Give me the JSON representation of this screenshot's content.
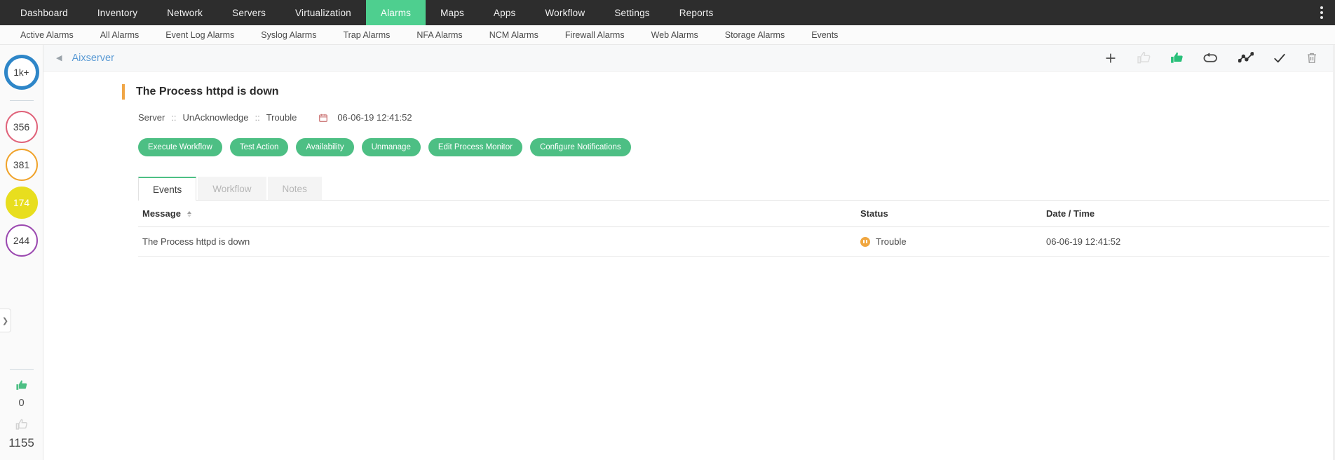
{
  "topnav": {
    "items": [
      {
        "label": "Dashboard",
        "active": false
      },
      {
        "label": "Inventory",
        "active": false
      },
      {
        "label": "Network",
        "active": false
      },
      {
        "label": "Servers",
        "active": false
      },
      {
        "label": "Virtualization",
        "active": false
      },
      {
        "label": "Alarms",
        "active": true
      },
      {
        "label": "Maps",
        "active": false
      },
      {
        "label": "Apps",
        "active": false
      },
      {
        "label": "Workflow",
        "active": false
      },
      {
        "label": "Settings",
        "active": false
      },
      {
        "label": "Reports",
        "active": false
      }
    ],
    "overflow_icon": "kebab-menu-icon",
    "active_color": "#4ecf8f",
    "background": "#2d2d2d"
  },
  "subnav": {
    "items": [
      {
        "label": "Active Alarms"
      },
      {
        "label": "All Alarms"
      },
      {
        "label": "Event Log Alarms"
      },
      {
        "label": "Syslog Alarms"
      },
      {
        "label": "Trap Alarms"
      },
      {
        "label": "NFA Alarms"
      },
      {
        "label": "NCM Alarms"
      },
      {
        "label": "Firewall Alarms"
      },
      {
        "label": "Web Alarms"
      },
      {
        "label": "Storage Alarms"
      },
      {
        "label": "Events"
      }
    ]
  },
  "rail": {
    "badges": [
      {
        "value": "1k+",
        "color": "#2e86c8",
        "style": "donut"
      },
      {
        "value": "356",
        "color": "#e0637a",
        "style": "ring"
      },
      {
        "value": "381",
        "color": "#f0a32b",
        "style": "ring"
      },
      {
        "value": "174",
        "color": "#e8de1e",
        "style": "filled"
      },
      {
        "value": "244",
        "color": "#9b49b0",
        "style": "ring"
      }
    ],
    "stats": [
      {
        "icon": "thumbs-up-icon",
        "value": "0",
        "color": "#4dbf84"
      },
      {
        "icon": "thumbs-up-outline-icon",
        "value": "1155",
        "color": "#d8d8d8"
      }
    ],
    "expand_icon": "chevron-right-icon"
  },
  "header": {
    "back_icon": "chevron-left-icon",
    "device_name": "Aixserver",
    "tools": [
      {
        "name": "add-icon",
        "label": "Add"
      },
      {
        "name": "thumbs-up-outline-icon",
        "label": "Unacknowledge"
      },
      {
        "name": "thumbs-up-filled-icon",
        "label": "Acknowledge"
      },
      {
        "name": "link-loop-icon",
        "label": "Link"
      },
      {
        "name": "line-chart-icon",
        "label": "Performance"
      },
      {
        "name": "check-icon",
        "label": "Clear"
      },
      {
        "name": "trash-icon",
        "label": "Delete"
      }
    ]
  },
  "alarm": {
    "title": "The Process httpd is down",
    "accent_color": "#f0a646",
    "category": "Server",
    "ack_state": "UnAcknowledge",
    "severity": "Trouble",
    "calendar_icon": "calendar-icon",
    "timestamp": "06-06-19 12:41:52",
    "separator": "::"
  },
  "actions": {
    "buttons": [
      {
        "label": "Execute Workflow"
      },
      {
        "label": "Test Action"
      },
      {
        "label": "Availability"
      },
      {
        "label": "Unmanage"
      },
      {
        "label": "Edit Process Monitor"
      },
      {
        "label": "Configure Notifications"
      }
    ],
    "color": "#4dbf84"
  },
  "tabs": [
    {
      "label": "Events",
      "active": true
    },
    {
      "label": "Workflow",
      "active": false
    },
    {
      "label": "Notes",
      "active": false
    }
  ],
  "table": {
    "columns": [
      "Message",
      "Status",
      "Date / Time"
    ],
    "sort_column": "Message",
    "sort_direction": "asc",
    "rows": [
      {
        "message": "The Process httpd is down",
        "status": "Trouble",
        "status_icon": "trouble-icon",
        "status_color": "#f0a63f",
        "datetime": "06-06-19 12:41:52"
      }
    ]
  }
}
